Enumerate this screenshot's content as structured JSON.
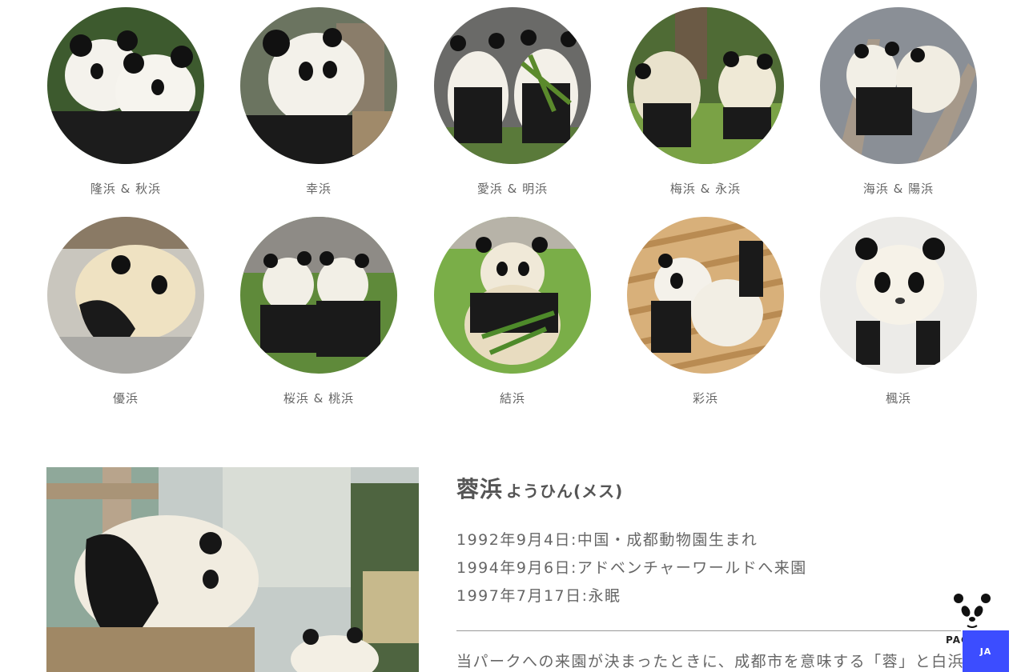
{
  "pandas": [
    {
      "label": "隆浜 & 秋浜"
    },
    {
      "label": "幸浜"
    },
    {
      "label": "愛浜 & 明浜"
    },
    {
      "label": "梅浜 & 永浜"
    },
    {
      "label": "海浜 & 陽浜"
    },
    {
      "label": "優浜"
    },
    {
      "label": "桜浜 & 桃浜"
    },
    {
      "label": "結浜"
    },
    {
      "label": "彩浜"
    },
    {
      "label": "楓浜"
    }
  ],
  "detail": {
    "name": "蓉浜",
    "reading": "ようひん(メス)",
    "facts": [
      "1992年9月4日:中国・成都動物園生まれ",
      "1994年9月6日:アドベンチャーワールドへ来園",
      "1997年7月17日:永眠"
    ],
    "description": "当パークへの来園が決まったときに、成都市を意味する「蓉」と白浜町"
  },
  "pagetop": {
    "label": "PAGE"
  },
  "language": {
    "label": "JA"
  },
  "colors": {
    "accent": "#3c4dff",
    "text": "#666666"
  }
}
